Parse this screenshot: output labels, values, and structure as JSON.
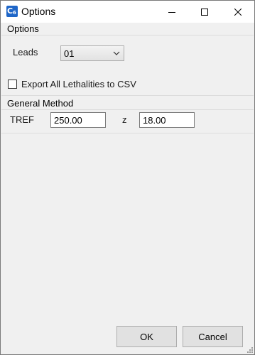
{
  "window": {
    "title": "Options",
    "icon": "app-logo-icon",
    "icon_text": "C",
    "icon_subtext": "6"
  },
  "options_group": {
    "title": "Options",
    "leads_label": "Leads",
    "leads_value": "01",
    "export_label": "Export All Lethalities to CSV",
    "export_checked": false
  },
  "general_method": {
    "title": "General Method",
    "tref_label": "TREF",
    "tref_value": "250.00",
    "z_label": "z",
    "z_value": "18.00"
  },
  "buttons": {
    "ok": "OK",
    "cancel": "Cancel"
  }
}
